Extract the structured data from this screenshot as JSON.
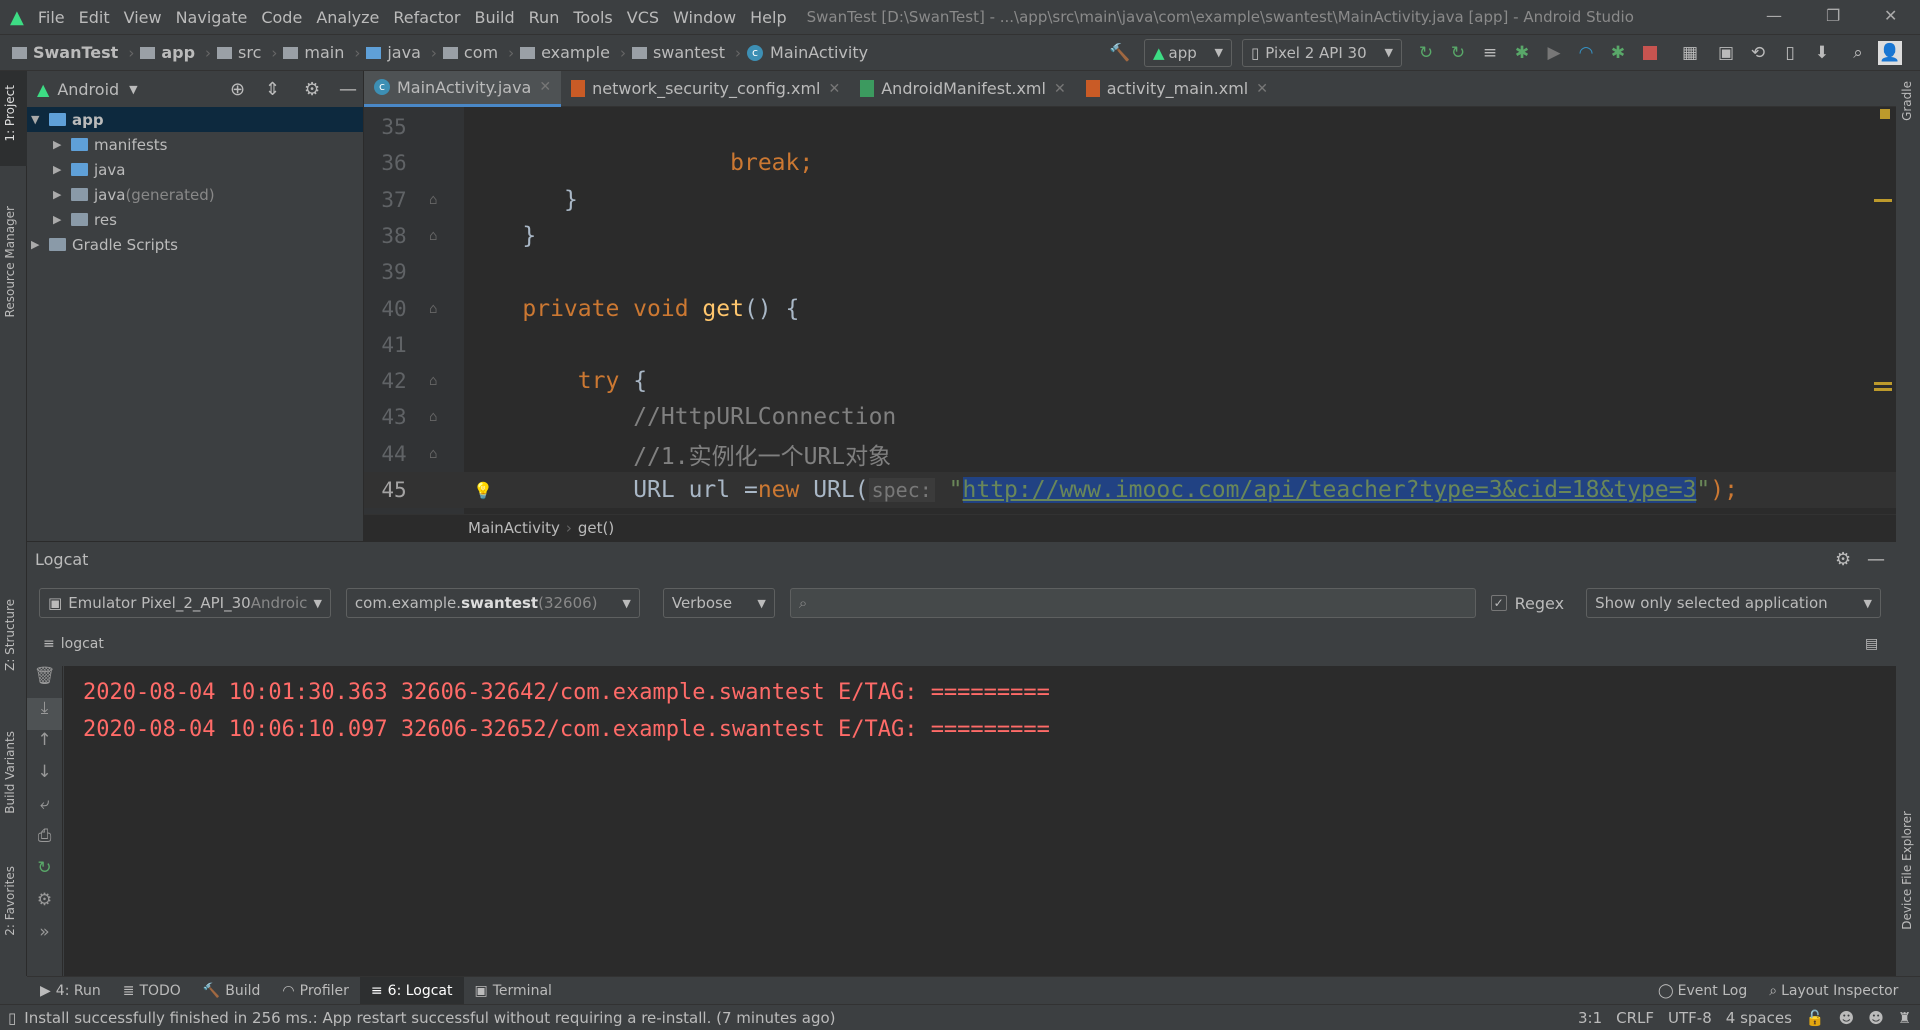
{
  "menu": {
    "items": [
      "File",
      "Edit",
      "View",
      "Navigate",
      "Code",
      "Analyze",
      "Refactor",
      "Build",
      "Run",
      "Tools",
      "VCS",
      "Window",
      "Help"
    ],
    "title": "SwanTest [D:\\SwanTest] - ...\\app\\src\\main\\java\\com\\example\\swantest\\MainActivity.java [app] - Android Studio"
  },
  "nav": {
    "crumbs": [
      "SwanTest",
      "app",
      "src",
      "main",
      "java",
      "com",
      "example",
      "swantest",
      "MainActivity"
    ],
    "run_config": "app",
    "device": "Pixel 2 API 30"
  },
  "project": {
    "view": "Android",
    "tree": [
      {
        "label": "app",
        "level": 0,
        "open": true,
        "sel": true
      },
      {
        "label": "manifests",
        "level": 1
      },
      {
        "label": "java",
        "level": 1
      },
      {
        "label": "java",
        "suffix": " (generated)",
        "level": 1
      },
      {
        "label": "res",
        "level": 1
      },
      {
        "label": "Gradle Scripts",
        "level": 0
      }
    ]
  },
  "tabs": [
    {
      "label": "MainActivity.java",
      "icon": "class",
      "active": true
    },
    {
      "label": "network_security_config.xml",
      "icon": "xml"
    },
    {
      "label": "AndroidManifest.xml",
      "icon": "manifest"
    },
    {
      "label": "activity_main.xml",
      "icon": "xml"
    }
  ],
  "code": [
    {
      "n": "35",
      "indent": 0,
      "tokens": []
    },
    {
      "n": "36",
      "indent": 19,
      "tokens": [
        {
          "t": "break",
          "c": "k"
        },
        {
          "t": ";",
          "c": "k"
        }
      ]
    },
    {
      "n": "37",
      "indent": 7,
      "tokens": [
        {
          "t": "}",
          "c": ""
        }
      ]
    },
    {
      "n": "38",
      "indent": 4,
      "tokens": [
        {
          "t": "}",
          "c": ""
        }
      ]
    },
    {
      "n": "39",
      "indent": 0,
      "tokens": []
    },
    {
      "n": "40",
      "indent": 4,
      "tokens": [
        {
          "t": "private void ",
          "c": "k"
        },
        {
          "t": "get",
          "c": "fn"
        },
        {
          "t": "() {",
          "c": ""
        }
      ]
    },
    {
      "n": "41",
      "indent": 0,
      "tokens": []
    },
    {
      "n": "42",
      "indent": 8,
      "tokens": [
        {
          "t": "try ",
          "c": "k"
        },
        {
          "t": "{",
          "c": ""
        }
      ]
    },
    {
      "n": "43",
      "indent": 12,
      "tokens": [
        {
          "t": "//HttpURLConnection",
          "c": "cm"
        }
      ]
    },
    {
      "n": "44",
      "indent": 12,
      "tokens": [
        {
          "t": "//1.实例化一个URL对象",
          "c": "cm"
        }
      ]
    },
    {
      "n": "45",
      "indent": 12,
      "cur": true,
      "tokens": [
        {
          "t": "URL url =",
          "c": ""
        },
        {
          "t": "new ",
          "c": "k"
        },
        {
          "t": "URL(",
          "c": ""
        },
        {
          "t": "spec:",
          "c": "hint"
        },
        {
          "t": " \"",
          "c": "s0"
        },
        {
          "t": "http://www.imooc.com/api/teacher?type=3&cid=18&type=3",
          "c": "s sel"
        },
        {
          "t": "\"",
          "c": "s0"
        },
        {
          "t": ");",
          "c": "k"
        }
      ]
    }
  ],
  "editor_crumbs": [
    "MainActivity",
    "get()"
  ],
  "logcat": {
    "title": "Logcat",
    "device": "Emulator Pixel_2_API_30",
    "device_suffix": " Androic",
    "process": "com.example.",
    "process_bold": "swantest",
    "pid": " (32606)",
    "level": "Verbose",
    "search": "",
    "regex_label": "Regex",
    "regex_checked": true,
    "filter": "Show only selected application",
    "sub": "logcat",
    "lines": [
      "2020-08-04 10:01:30.363 32606-32642/com.example.swantest E/TAG: =========",
      "2020-08-04 10:06:10.097 32606-32652/com.example.swantest E/TAG: ========="
    ]
  },
  "side_left": [
    "1: Project",
    "Resource Manager",
    "Z: Structure",
    "Build Variants",
    "2: Favorites"
  ],
  "side_right": [
    "Gradle",
    "Device File Explorer"
  ],
  "toolwindows": [
    "4: Run",
    "TODO",
    "Build",
    "Profiler",
    "6: Logcat",
    "Terminal"
  ],
  "toolwindows_right": [
    "Event Log",
    "Layout Inspector"
  ],
  "status": {
    "message": "Install successfully finished in 256 ms.: App restart successful without requiring a re-install. (7 minutes ago)",
    "pos": "3:1",
    "eol": "CRLF",
    "enc": "UTF-8",
    "indent": "4 spaces"
  },
  "colors": {
    "accent": "#4a88c7",
    "keyword": "#cc7832",
    "string": "#6a8759",
    "log_error": "#ff6b68",
    "selection": "#214283"
  }
}
